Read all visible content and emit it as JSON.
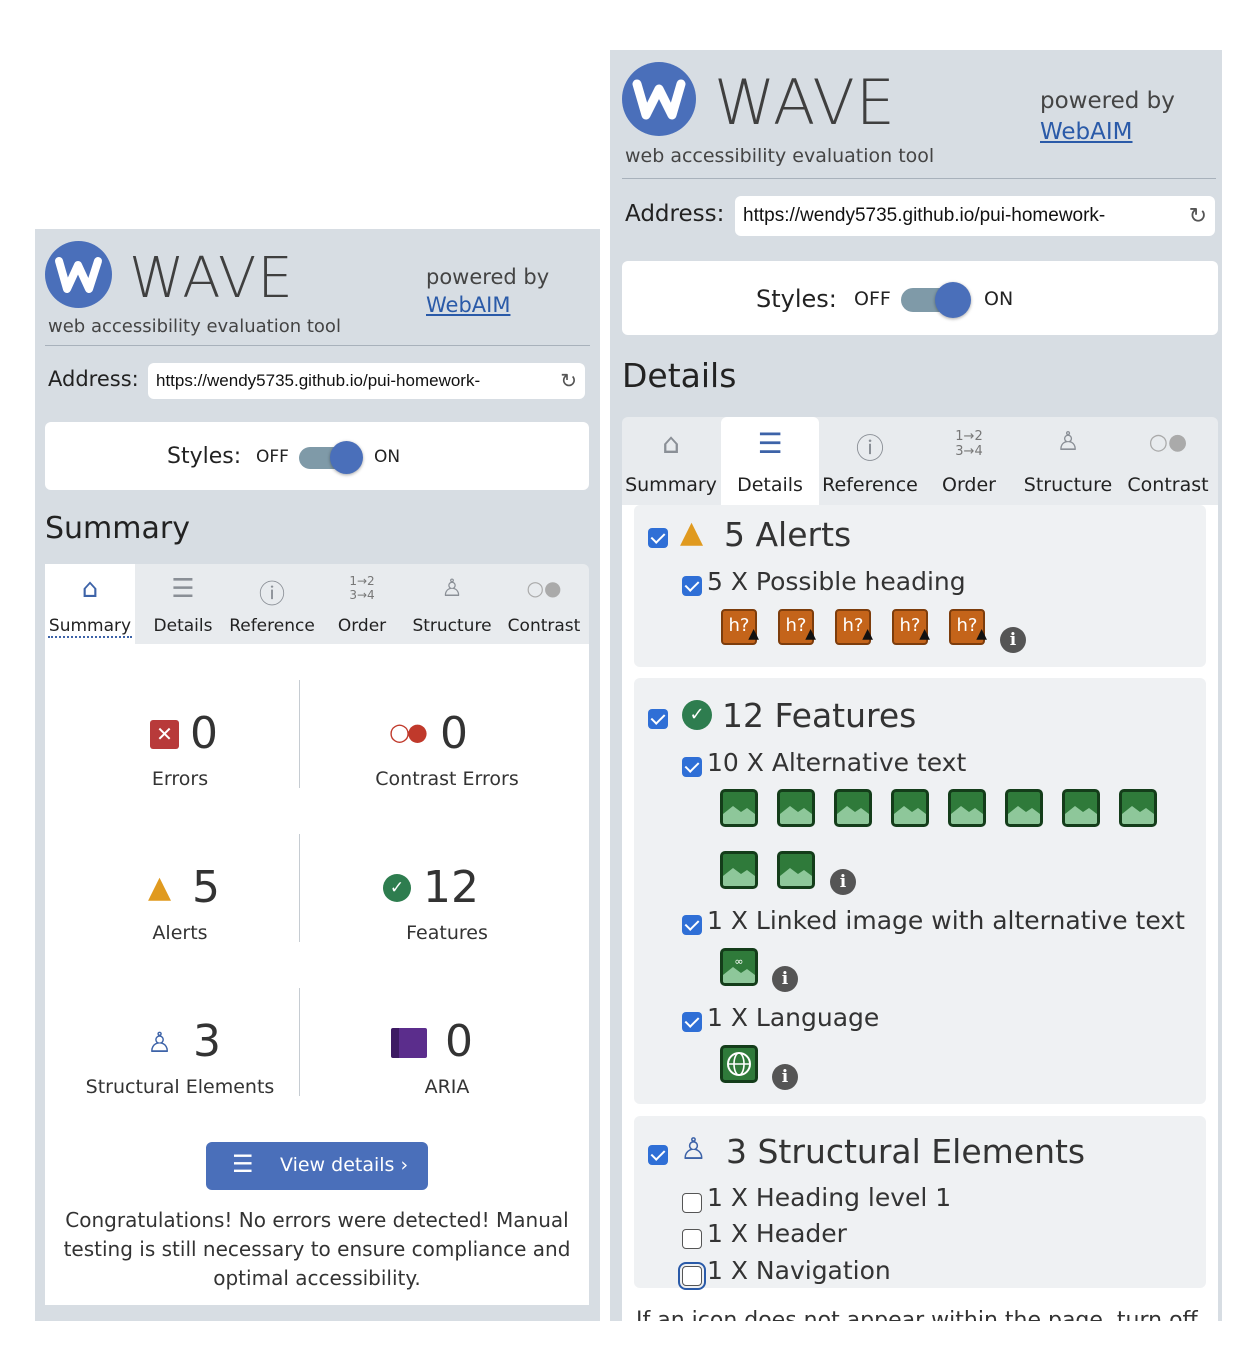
{
  "brand": {
    "name": "WAVE",
    "tagline": "web accessibility evaluation tool",
    "powered_by": "powered by",
    "webaim_link": "WebAIM"
  },
  "address": {
    "label": "Address:",
    "url": "https://wendy5735.github.io/pui-homework-",
    "reload_icon": "↻"
  },
  "styles_toggle": {
    "label": "Styles:",
    "off": "OFF",
    "on": "ON",
    "state": "on"
  },
  "tabs": [
    {
      "label": "Summary",
      "icon": "home-icon"
    },
    {
      "label": "Details",
      "icon": "list-icon"
    },
    {
      "label": "Reference",
      "icon": "info-icon"
    },
    {
      "label": "Order",
      "icon": "order-icon"
    },
    {
      "label": "Structure",
      "icon": "structure-icon"
    },
    {
      "label": "Contrast",
      "icon": "contrast-icon"
    }
  ],
  "summary": {
    "title": "Summary",
    "stats": [
      {
        "count": "0",
        "label": "Errors",
        "icon": "error-icon",
        "color": "#c0392b"
      },
      {
        "count": "0",
        "label": "Contrast Errors",
        "icon": "contrast-error-icon",
        "color": "#c0392b"
      },
      {
        "count": "5",
        "label": "Alerts",
        "icon": "alert-icon",
        "color": "#e09a1f"
      },
      {
        "count": "12",
        "label": "Features",
        "icon": "feature-icon",
        "color": "#2e7d4f"
      },
      {
        "count": "3",
        "label": "Structural Elements",
        "icon": "structure-icon",
        "color": "#3d63a8"
      },
      {
        "count": "0",
        "label": "ARIA",
        "icon": "aria-icon",
        "color": "#5b2d8c"
      }
    ],
    "view_details": "View details ›",
    "congrats": "Congratulations! No errors were detected! Manual testing is still necessary to ensure compliance and optimal accessibility."
  },
  "details": {
    "title": "Details",
    "alerts": {
      "heading": "5 Alerts",
      "items": [
        {
          "label": "5 X Possible heading",
          "badge": "h?"
        }
      ]
    },
    "features": {
      "heading": "12 Features",
      "items": [
        {
          "label": "10 X Alternative text"
        },
        {
          "label": "1 X Linked image with alternative text"
        },
        {
          "label": "1 X Language"
        }
      ]
    },
    "structure": {
      "heading": "3 Structural Elements",
      "items": [
        {
          "label": "1 X Heading level 1"
        },
        {
          "label": "1 X Header"
        },
        {
          "label": "1 X Navigation"
        }
      ]
    },
    "footnote": "If an icon does not appear within the page, turn off"
  },
  "colors": {
    "panel_bg": "#d7dde3",
    "brand_blue": "#4a6fba",
    "link_blue": "#2a5aa8",
    "alert_orange": "#c4641a",
    "feature_green": "#2f7a3a"
  }
}
